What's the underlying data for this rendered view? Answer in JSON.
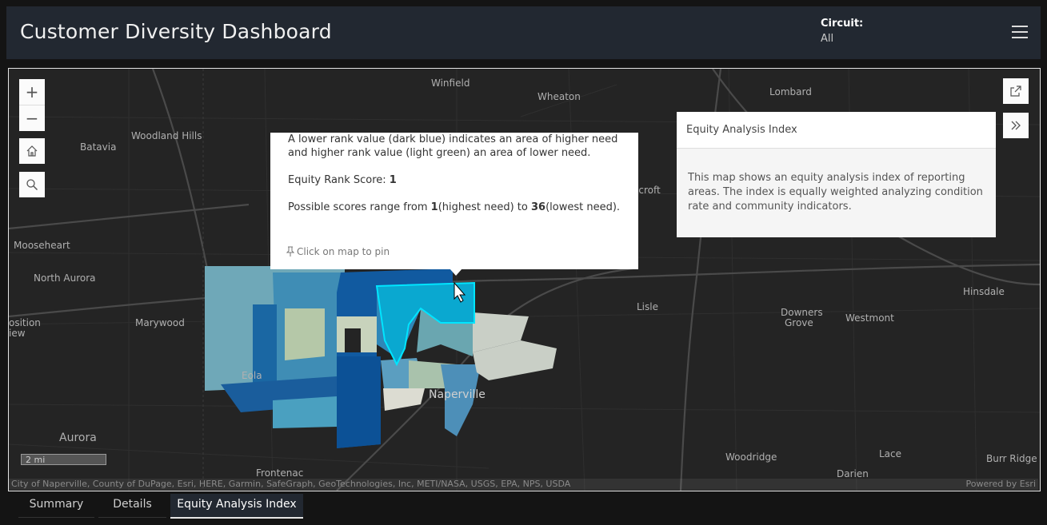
{
  "header": {
    "title": "Customer Diversity Dashboard",
    "circuit_label": "Circuit:",
    "circuit_value": "All"
  },
  "map": {
    "places": [
      "Winfield",
      "Wheaton",
      "Lombard",
      "Woodland Hills",
      "Batavia",
      "Mooseheart",
      "North Aurora",
      "Marywood",
      "Lisle",
      "Downers Grove",
      "Westmont",
      "Hinsdale",
      "Eola",
      "Naperville",
      "Aurora",
      "Frontenac",
      "Woodridge",
      "Lace",
      "Darien",
      "Burr Ridge",
      "ecroft",
      "osition iew"
    ],
    "scale_label": "2 mi",
    "attribution": "City of Naperville, County of DuPage, Esri, HERE, Garmin, SafeGraph, GeoTechnologies, Inc, METI/NASA, USGS, EPA, NPS, USDA",
    "powered_by": "Powered by Esri"
  },
  "popup": {
    "line1": "A lower rank value (dark blue) indicates an area of higher need and higher rank value (light green) an area of lower need.",
    "score_label": "Equity Rank Score: ",
    "score_value": "1",
    "range_prefix": "Possible scores range from ",
    "range_low": "1",
    "range_mid": "(highest need) to ",
    "range_high": "36",
    "range_suffix": "(lowest need).",
    "pin_label": "Click on map to pin"
  },
  "legend": {
    "title": "Equity Analysis Index",
    "description": "This map shows an equity analysis index of reporting areas. The index is equally weighted analyzing condition rate and community indicators."
  },
  "tabs": [
    {
      "label": "Summary"
    },
    {
      "label": "Details"
    },
    {
      "label": "Equity Analysis Index"
    }
  ],
  "colors": {
    "header_bg": "#222831",
    "dark_blue": "#0d5a9b",
    "mid_blue": "#2f87b8",
    "teal": "#5aa8b8",
    "light_green": "#a8c4a8",
    "highlight": "#00e5ff"
  }
}
